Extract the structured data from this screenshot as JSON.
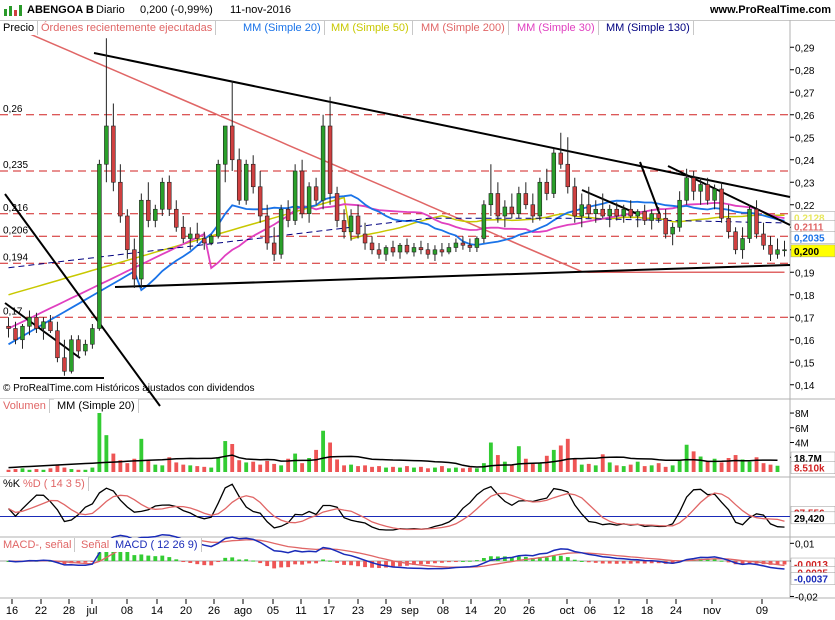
{
  "top_bar": {
    "ticker": "ABENGOA B",
    "period": "Diario",
    "last": "0,200 (-0,99%)",
    "date": "11-nov-2016",
    "site": "www.ProRealTime.com"
  },
  "price_panel": {
    "labels": [
      "Precio",
      "Órdenes recientemente ejecutadas",
      "MM (Simple 20)",
      "MM (Simple 50)",
      "MM (Simple 200)",
      "MM (Simple 30)",
      "MM (Simple 130)"
    ],
    "label_colors": [
      "#000000",
      "#e06666",
      "#1a73e8",
      "#c8c800",
      "#e06666",
      "#e040c0",
      "#000080"
    ],
    "credit": "© ProRealTime.com Históricos ajustados con dividendos",
    "axis_ticks": [
      "0,29",
      "0,28",
      "0,27",
      "0,26",
      "0,25",
      "0,24",
      "0,23",
      "0,22",
      "0,21",
      "0,2",
      "0,19",
      "0,18",
      "0,17",
      "0,16",
      "0,15",
      "0,14"
    ],
    "axis_tick_values": [
      0.29,
      0.28,
      0.27,
      0.26,
      0.25,
      0.24,
      0.23,
      0.22,
      0.21,
      0.2,
      0.19,
      0.18,
      0.17,
      0.16,
      0.15,
      0.14
    ],
    "ref_levels": [
      {
        "label": "0,26",
        "value": 0.26
      },
      {
        "label": "0,235",
        "value": 0.235
      },
      {
        "label": "0,216",
        "value": 0.216
      },
      {
        "label": "0,206",
        "value": 0.206
      },
      {
        "label": "0,194",
        "value": 0.194
      },
      {
        "label": "0,17",
        "value": 0.17
      }
    ],
    "value_tags": [
      {
        "label": "0,2128",
        "value": 0.2128,
        "color": "#e8e860"
      },
      {
        "label": "0,2111",
        "value": 0.2111,
        "color": "#e06666"
      },
      {
        "label": "0,2035",
        "value": 0.2035,
        "color": "#1a73e8"
      },
      {
        "label": "0,200",
        "value": 0.2,
        "color": "#ffff00"
      }
    ]
  },
  "volume_panel": {
    "labels": [
      "Volumen",
      "MM (Simple 20)"
    ],
    "axis_ticks": [
      "8M",
      "6M",
      "4M",
      "2M"
    ],
    "axis_tick_values": [
      8,
      6,
      4,
      2
    ],
    "value_tags": [
      {
        "label": "18,7M",
        "value": 1.9
      },
      {
        "label": "8.510k",
        "value": 0.85
      }
    ]
  },
  "stoch_panel": {
    "labels": [
      "%K",
      "%D ( 14 3 5)"
    ],
    "value_tags": [
      {
        "label": "37,556",
        "value": 37.556
      },
      {
        "label": "29,420",
        "value": 29.42
      }
    ]
  },
  "macd_panel": {
    "labels": [
      "MACD-, señal",
      "Señal",
      "MACD ( 12 26 9)"
    ],
    "axis_ticks": [
      "0,01",
      "0",
      "-0,02"
    ],
    "axis_tick_values": [
      0.01,
      0,
      -0.02
    ],
    "value_tags": [
      {
        "label": "-0,0013",
        "value": -0.0013
      },
      {
        "label": "-0,0025",
        "value": -0.0025
      },
      {
        "label": "-0,0037",
        "value": -0.0037
      }
    ]
  },
  "x_axis": {
    "labels": [
      "16",
      "22",
      "28",
      "jul",
      "08",
      "14",
      "20",
      "26",
      "ago",
      "05",
      "11",
      "17",
      "23",
      "29",
      "sep",
      "08",
      "14",
      "20",
      "26",
      "oct",
      "06",
      "12",
      "18",
      "24",
      "nov",
      "09"
    ]
  },
  "chart_data": {
    "type": "candlestick",
    "title": "ABENGOA B Diario",
    "ylim": [
      0.135,
      0.295
    ],
    "ohlc": [
      [
        0.166,
        0.17,
        0.161,
        0.165
      ],
      [
        0.165,
        0.168,
        0.158,
        0.16
      ],
      [
        0.16,
        0.167,
        0.156,
        0.166
      ],
      [
        0.166,
        0.173,
        0.162,
        0.17
      ],
      [
        0.17,
        0.172,
        0.163,
        0.165
      ],
      [
        0.165,
        0.17,
        0.16,
        0.168
      ],
      [
        0.168,
        0.171,
        0.163,
        0.164
      ],
      [
        0.164,
        0.168,
        0.15,
        0.152
      ],
      [
        0.152,
        0.16,
        0.144,
        0.146
      ],
      [
        0.146,
        0.162,
        0.145,
        0.16
      ],
      [
        0.16,
        0.162,
        0.152,
        0.155
      ],
      [
        0.155,
        0.16,
        0.153,
        0.158
      ],
      [
        0.158,
        0.167,
        0.156,
        0.165
      ],
      [
        0.165,
        0.24,
        0.164,
        0.238
      ],
      [
        0.238,
        0.294,
        0.23,
        0.255
      ],
      [
        0.255,
        0.265,
        0.226,
        0.23
      ],
      [
        0.23,
        0.238,
        0.212,
        0.215
      ],
      [
        0.215,
        0.218,
        0.196,
        0.2
      ],
      [
        0.2,
        0.205,
        0.183,
        0.187
      ],
      [
        0.187,
        0.225,
        0.183,
        0.222
      ],
      [
        0.222,
        0.23,
        0.21,
        0.213
      ],
      [
        0.213,
        0.22,
        0.21,
        0.218
      ],
      [
        0.218,
        0.232,
        0.215,
        0.23
      ],
      [
        0.23,
        0.233,
        0.215,
        0.218
      ],
      [
        0.218,
        0.222,
        0.208,
        0.21
      ],
      [
        0.21,
        0.215,
        0.203,
        0.205
      ],
      [
        0.205,
        0.21,
        0.2,
        0.207
      ],
      [
        0.207,
        0.212,
        0.203,
        0.205
      ],
      [
        0.205,
        0.208,
        0.2,
        0.203
      ],
      [
        0.203,
        0.207,
        0.202,
        0.206
      ],
      [
        0.206,
        0.24,
        0.205,
        0.238
      ],
      [
        0.238,
        0.25,
        0.23,
        0.255
      ],
      [
        0.255,
        0.275,
        0.235,
        0.24
      ],
      [
        0.24,
        0.245,
        0.22,
        0.222
      ],
      [
        0.222,
        0.24,
        0.22,
        0.238
      ],
      [
        0.238,
        0.242,
        0.225,
        0.228
      ],
      [
        0.228,
        0.235,
        0.212,
        0.215
      ],
      [
        0.215,
        0.22,
        0.2,
        0.203
      ],
      [
        0.203,
        0.21,
        0.195,
        0.198
      ],
      [
        0.198,
        0.22,
        0.196,
        0.218
      ],
      [
        0.218,
        0.222,
        0.21,
        0.213
      ],
      [
        0.213,
        0.238,
        0.211,
        0.235
      ],
      [
        0.235,
        0.24,
        0.214,
        0.216
      ],
      [
        0.216,
        0.23,
        0.212,
        0.228
      ],
      [
        0.228,
        0.232,
        0.22,
        0.222
      ],
      [
        0.222,
        0.26,
        0.218,
        0.255
      ],
      [
        0.255,
        0.268,
        0.22,
        0.225
      ],
      [
        0.225,
        0.228,
        0.21,
        0.213
      ],
      [
        0.213,
        0.218,
        0.205,
        0.208
      ],
      [
        0.208,
        0.218,
        0.204,
        0.215
      ],
      [
        0.215,
        0.22,
        0.205,
        0.207
      ],
      [
        0.207,
        0.212,
        0.2,
        0.203
      ],
      [
        0.203,
        0.206,
        0.198,
        0.2
      ],
      [
        0.2,
        0.203,
        0.196,
        0.198
      ],
      [
        0.198,
        0.202,
        0.195,
        0.201
      ],
      [
        0.201,
        0.204,
        0.197,
        0.199
      ],
      [
        0.199,
        0.203,
        0.196,
        0.202
      ],
      [
        0.202,
        0.205,
        0.198,
        0.199
      ],
      [
        0.199,
        0.203,
        0.197,
        0.201
      ],
      [
        0.201,
        0.204,
        0.198,
        0.2
      ],
      [
        0.2,
        0.203,
        0.196,
        0.198
      ],
      [
        0.198,
        0.202,
        0.195,
        0.2
      ],
      [
        0.2,
        0.203,
        0.197,
        0.199
      ],
      [
        0.199,
        0.203,
        0.198,
        0.201
      ],
      [
        0.201,
        0.205,
        0.199,
        0.203
      ],
      [
        0.203,
        0.206,
        0.2,
        0.202
      ],
      [
        0.202,
        0.205,
        0.199,
        0.201
      ],
      [
        0.201,
        0.206,
        0.199,
        0.205
      ],
      [
        0.205,
        0.222,
        0.203,
        0.22
      ],
      [
        0.22,
        0.238,
        0.215,
        0.225
      ],
      [
        0.225,
        0.23,
        0.212,
        0.215
      ],
      [
        0.215,
        0.222,
        0.21,
        0.219
      ],
      [
        0.219,
        0.225,
        0.214,
        0.216
      ],
      [
        0.216,
        0.228,
        0.214,
        0.225
      ],
      [
        0.225,
        0.23,
        0.218,
        0.22
      ],
      [
        0.22,
        0.225,
        0.212,
        0.215
      ],
      [
        0.215,
        0.232,
        0.213,
        0.23
      ],
      [
        0.23,
        0.236,
        0.222,
        0.225
      ],
      [
        0.225,
        0.245,
        0.223,
        0.243
      ],
      [
        0.243,
        0.252,
        0.236,
        0.238
      ],
      [
        0.238,
        0.25,
        0.225,
        0.228
      ],
      [
        0.228,
        0.232,
        0.212,
        0.215
      ],
      [
        0.215,
        0.225,
        0.21,
        0.22
      ],
      [
        0.22,
        0.228,
        0.214,
        0.216
      ],
      [
        0.216,
        0.222,
        0.212,
        0.218
      ],
      [
        0.218,
        0.225,
        0.214,
        0.215
      ],
      [
        0.215,
        0.22,
        0.21,
        0.218
      ],
      [
        0.218,
        0.221,
        0.213,
        0.215
      ],
      [
        0.215,
        0.22,
        0.212,
        0.218
      ],
      [
        0.218,
        0.222,
        0.214,
        0.215
      ],
      [
        0.215,
        0.218,
        0.21,
        0.217
      ],
      [
        0.217,
        0.22,
        0.211,
        0.213
      ],
      [
        0.213,
        0.218,
        0.209,
        0.216
      ],
      [
        0.216,
        0.219,
        0.212,
        0.214
      ],
      [
        0.214,
        0.218,
        0.205,
        0.207
      ],
      [
        0.207,
        0.212,
        0.202,
        0.21
      ],
      [
        0.21,
        0.226,
        0.208,
        0.222
      ],
      [
        0.222,
        0.236,
        0.22,
        0.232
      ],
      [
        0.232,
        0.235,
        0.222,
        0.226
      ],
      [
        0.226,
        0.232,
        0.22,
        0.229
      ],
      [
        0.229,
        0.232,
        0.22,
        0.222
      ],
      [
        0.222,
        0.229,
        0.218,
        0.227
      ],
      [
        0.227,
        0.23,
        0.212,
        0.214
      ],
      [
        0.214,
        0.22,
        0.205,
        0.208
      ],
      [
        0.208,
        0.21,
        0.198,
        0.2
      ],
      [
        0.2,
        0.21,
        0.196,
        0.205
      ],
      [
        0.205,
        0.22,
        0.203,
        0.218
      ],
      [
        0.218,
        0.222,
        0.205,
        0.207
      ],
      [
        0.207,
        0.212,
        0.2,
        0.202
      ],
      [
        0.202,
        0.206,
        0.195,
        0.198
      ],
      [
        0.198,
        0.205,
        0.196,
        0.2
      ],
      [
        0.2,
        0.204,
        0.197,
        0.2
      ]
    ],
    "volume_millions": [
      0.3,
      0.4,
      0.5,
      0.3,
      0.4,
      0.3,
      0.5,
      0.9,
      0.6,
      0.4,
      0.3,
      0.3,
      0.6,
      8.5,
      5.0,
      2.5,
      1.6,
      1.2,
      1.8,
      4.5,
      1.5,
      1.0,
      0.9,
      2.0,
      1.3,
      1.0,
      0.9,
      0.8,
      0.7,
      0.6,
      2.0,
      4.2,
      3.8,
      1.6,
      1.3,
      1.4,
      1.0,
      1.5,
      1.1,
      0.9,
      1.8,
      2.5,
      1.2,
      1.9,
      3.0,
      5.6,
      4.0,
      1.7,
      0.9,
      1.0,
      0.8,
      0.9,
      0.7,
      0.8,
      0.6,
      0.7,
      0.6,
      0.8,
      0.6,
      0.7,
      0.5,
      0.6,
      0.8,
      0.5,
      0.6,
      0.5,
      0.6,
      0.5,
      1.2,
      4.0,
      2.3,
      1.4,
      1.0,
      3.5,
      1.8,
      1.1,
      1.3,
      2.2,
      3.0,
      3.6,
      4.5,
      1.9,
      1.0,
      1.1,
      0.9,
      2.4,
      1.3,
      0.9,
      0.8,
      1.0,
      1.4,
      0.8,
      0.9,
      1.2,
      0.7,
      0.9,
      1.6,
      3.7,
      2.8,
      2.1,
      1.5,
      1.8,
      1.3,
      1.9,
      2.3,
      1.7,
      1.4,
      2.0,
      1.2,
      1.0,
      0.85
    ]
  }
}
